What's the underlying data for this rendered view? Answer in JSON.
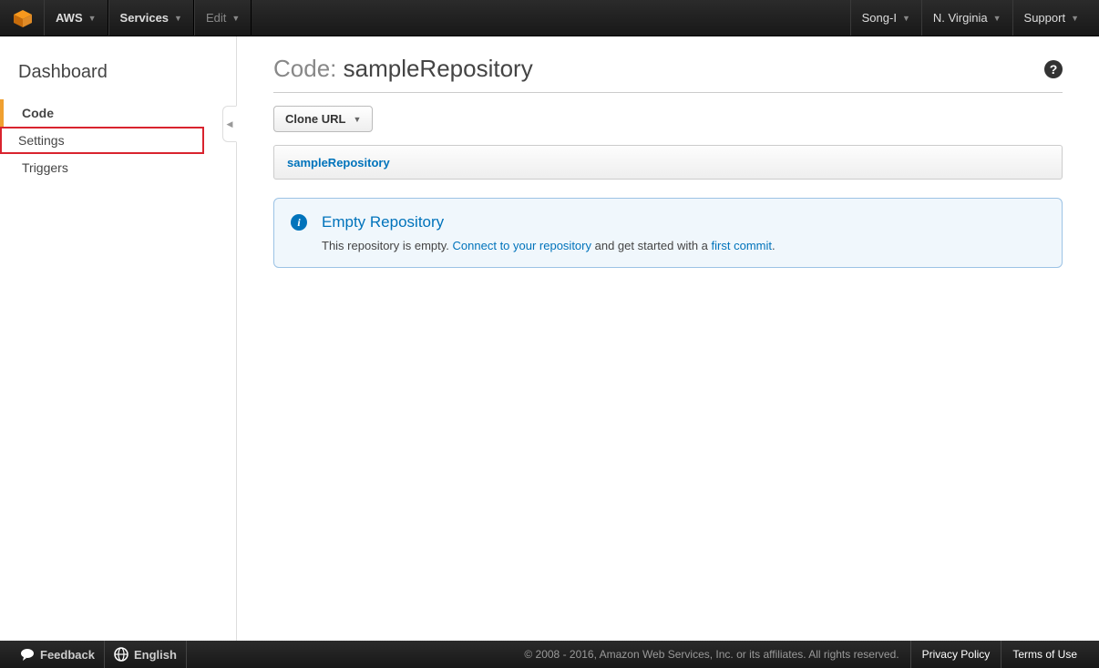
{
  "topnav": {
    "aws": "AWS",
    "services": "Services",
    "edit": "Edit",
    "user": "Song-I",
    "region": "N. Virginia",
    "support": "Support"
  },
  "sidebar": {
    "title": "Dashboard",
    "items": [
      {
        "label": "Code"
      },
      {
        "label": "Settings"
      },
      {
        "label": "Triggers"
      }
    ]
  },
  "page": {
    "title_prefix": "Code: ",
    "title_name": "sampleRepository",
    "clone_url": "Clone URL",
    "breadcrumb": "sampleRepository"
  },
  "info": {
    "title": "Empty Repository",
    "text_before": "This repository is empty. ",
    "link1": "Connect to your repository",
    "text_mid": " and get started with a ",
    "link2": "first commit",
    "text_after": "."
  },
  "footer": {
    "feedback": "Feedback",
    "language": "English",
    "copyright": "© 2008 - 2016, Amazon Web Services, Inc. or its affiliates. All rights reserved.",
    "privacy": "Privacy Policy",
    "terms": "Terms of Use"
  }
}
